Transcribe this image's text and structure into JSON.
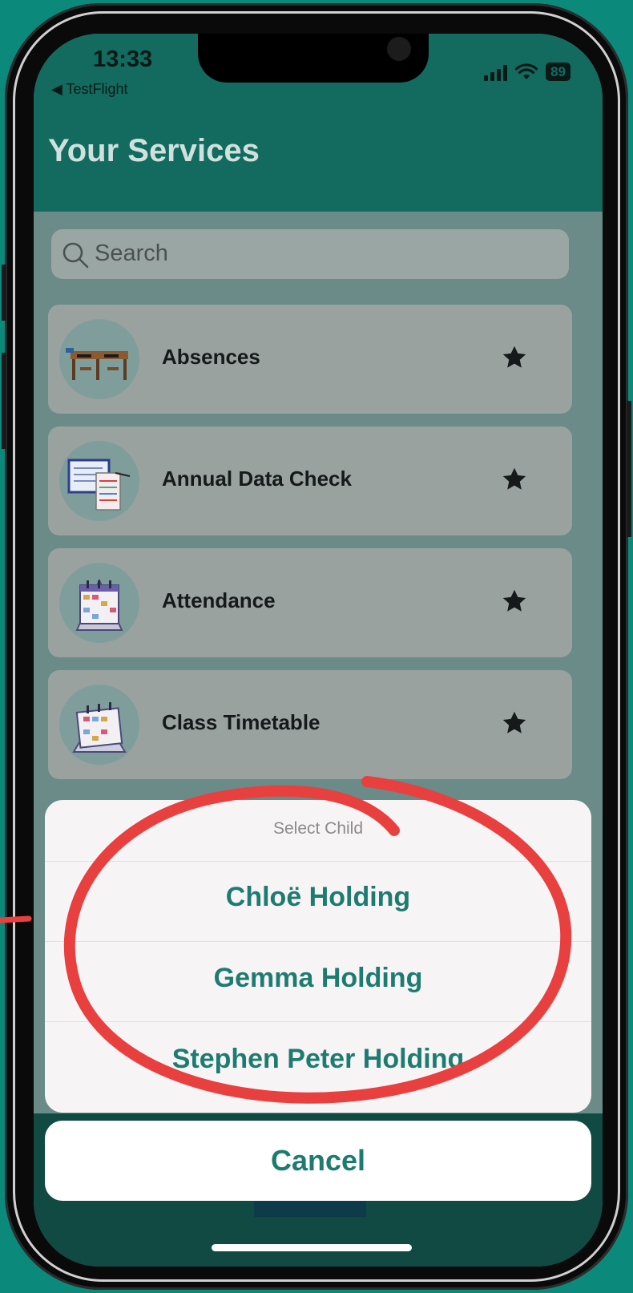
{
  "status_bar": {
    "time": "13:33",
    "back_app": "◀ TestFlight",
    "battery": "89"
  },
  "header": {
    "title": "Your Services"
  },
  "search": {
    "placeholder": "Search"
  },
  "services": [
    {
      "label": "Absences",
      "icon": "desks-icon",
      "favorite": true
    },
    {
      "label": "Annual Data Check",
      "icon": "data-screen-icon",
      "favorite": true
    },
    {
      "label": "Attendance",
      "icon": "calendar-icon",
      "favorite": true
    },
    {
      "label": "Class Timetable",
      "icon": "timetable-icon",
      "favorite": true
    }
  ],
  "action_sheet": {
    "title": "Select Child",
    "options": [
      "Chloë Holding",
      "Gemma Holding",
      "Stephen Peter Holding"
    ],
    "cancel": "Cancel"
  },
  "colors": {
    "header": "#136b60",
    "accent": "#1e7b70",
    "annotation": "#e8403f"
  }
}
